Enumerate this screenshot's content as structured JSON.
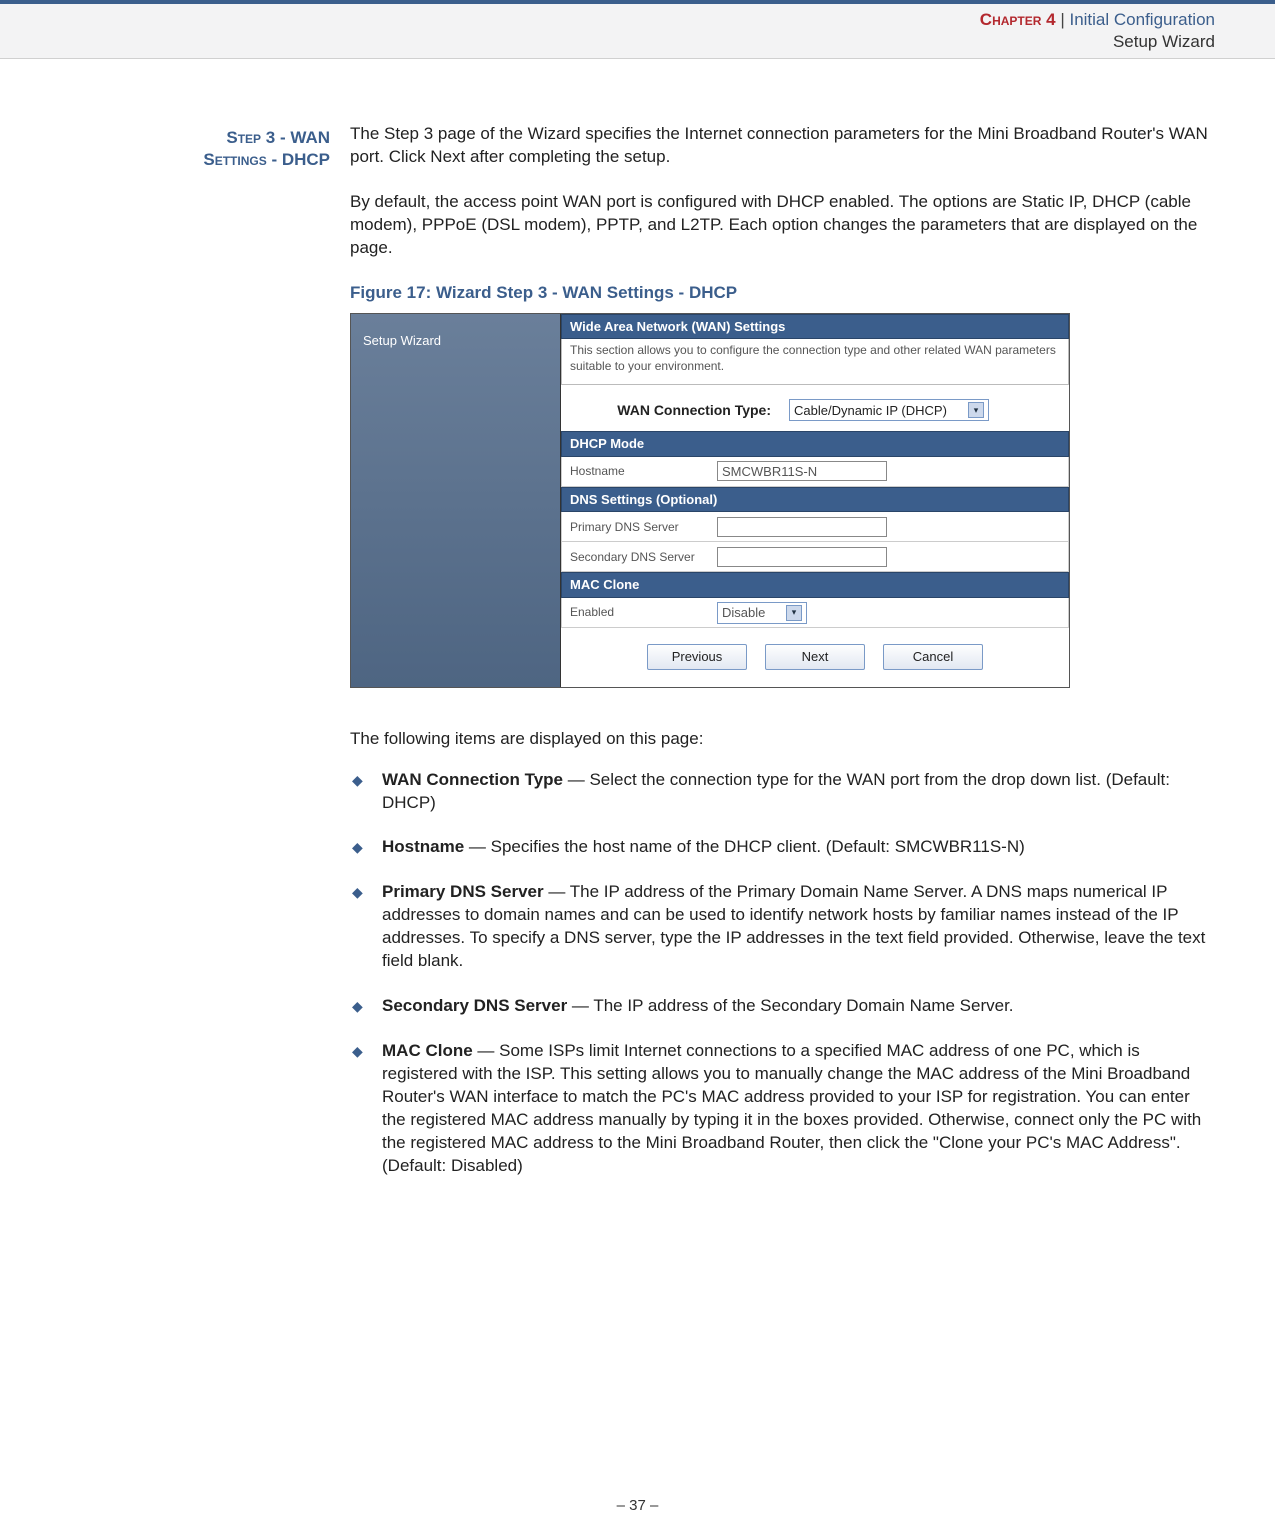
{
  "header": {
    "chapter_label": "Chapter 4",
    "separator": "  |  ",
    "chapter_title": "Initial Configuration",
    "subtitle": "Setup Wizard"
  },
  "step_heading_line1": "Step 3 - WAN",
  "step_heading_line2": "Settings - DHCP",
  "para1": "The Step 3 page of the Wizard specifies the Internet connection parameters for the Mini Broadband Router's WAN port. Click Next after completing the setup.",
  "para2": "By default, the access point WAN port is configured with DHCP enabled. The options are Static IP, DHCP (cable modem), PPPoE (DSL modem), PPTP, and L2TP. Each option changes the parameters that are displayed on the page.",
  "figure_caption": "Figure 17:  Wizard Step 3 - WAN Settings - DHCP",
  "screenshot": {
    "sidebar_label": "Setup Wizard",
    "panel_title": "Wide Area Network (WAN) Settings",
    "panel_desc": "This section allows you to configure the connection type and other related WAN parameters suitable to your environment.",
    "conn_label": "WAN Connection Type:",
    "conn_value": "Cable/Dynamic IP (DHCP)",
    "section_dhcp": "DHCP Mode",
    "hostname_label": "Hostname",
    "hostname_value": "SMCWBR11S-N",
    "section_dns": "DNS Settings (Optional)",
    "primary_dns_label": "Primary DNS Server",
    "primary_dns_value": "",
    "secondary_dns_label": "Secondary DNS Server",
    "secondary_dns_value": "",
    "section_mac": "MAC Clone",
    "mac_enable_label": "Enabled",
    "mac_enable_value": "Disable",
    "btn_prev": "Previous",
    "btn_next": "Next",
    "btn_cancel": "Cancel"
  },
  "items_intro": "The following items are displayed on this page:",
  "items": [
    {
      "term": "WAN Connection Type",
      "desc": " — Select the connection type for the WAN port from the drop down list. (Default: DHCP)"
    },
    {
      "term": "Hostname",
      "desc": " — Specifies the host name of the DHCP client. (Default: SMCWBR11S-N)"
    },
    {
      "term": "Primary DNS Server",
      "desc": " — The IP address of the Primary Domain Name Server. A DNS maps numerical IP addresses to domain names and can be used to identify network hosts by familiar names instead of the IP addresses. To specify a DNS server, type the IP addresses in the text field provided. Otherwise, leave the text field blank."
    },
    {
      "term": "Secondary DNS Server",
      "desc": " — The IP address of the Secondary Domain Name Server."
    },
    {
      "term": "MAC Clone",
      "desc": " — Some ISPs limit Internet connections to a specified MAC address of one PC, which is registered with the ISP. This setting allows you to manually change the MAC address of the Mini Broadband Router's WAN interface to match the PC's MAC address provided to your ISP for registration. You can enter the registered MAC address manually by typing it in the boxes provided. Otherwise, connect only the PC with the registered MAC address to the Mini Broadband Router, then click the \"Clone your PC's MAC Address\". (Default: Disabled)"
    }
  ],
  "footer": "–  37  –"
}
